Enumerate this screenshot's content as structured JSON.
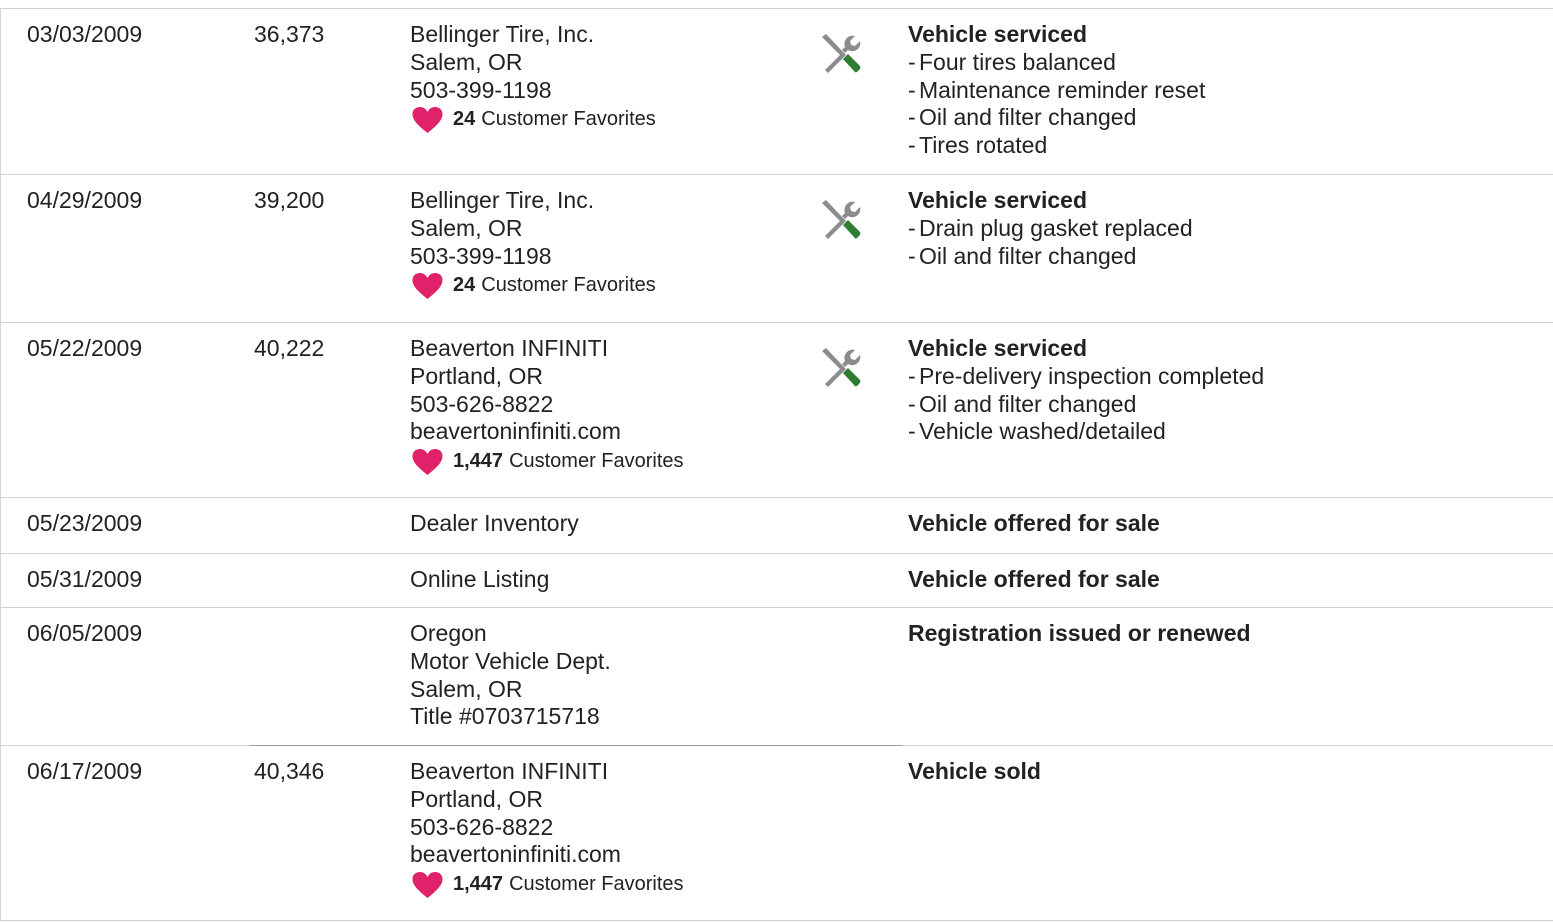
{
  "records": [
    {
      "date": "03/03/2009",
      "mileage": "36,373",
      "source": [
        "Bellinger Tire, Inc.",
        "Salem, OR",
        "503-399-1198"
      ],
      "favorites_count": "24",
      "favorites_label": "Customer Favorites",
      "icon": "service-tools-icon",
      "title": "Vehicle serviced",
      "items": [
        "Four tires balanced",
        "Maintenance reminder reset",
        "Oil and filter changed",
        "Tires rotated"
      ]
    },
    {
      "date": "04/29/2009",
      "mileage": "39,200",
      "source": [
        "Bellinger Tire, Inc.",
        "Salem, OR",
        "503-399-1198"
      ],
      "favorites_count": "24",
      "favorites_label": "Customer Favorites",
      "icon": "service-tools-icon",
      "title": "Vehicle serviced",
      "items": [
        "Drain plug gasket replaced",
        "Oil and filter changed"
      ]
    },
    {
      "date": "05/22/2009",
      "mileage": "40,222",
      "source": [
        "Beaverton INFINITI",
        "Portland, OR",
        "503-626-8822",
        "beavertoninfiniti.com"
      ],
      "favorites_count": "1,447",
      "favorites_label": "Customer Favorites",
      "icon": "service-tools-icon",
      "title": "Vehicle serviced",
      "items": [
        "Pre-delivery inspection completed",
        "Oil and filter changed",
        "Vehicle washed/detailed"
      ]
    },
    {
      "date": "05/23/2009",
      "mileage": "",
      "source": [
        "Dealer Inventory"
      ],
      "title": "Vehicle offered for sale",
      "items": []
    },
    {
      "date": "05/31/2009",
      "mileage": "",
      "source": [
        "Online Listing"
      ],
      "title": "Vehicle offered for sale",
      "items": []
    },
    {
      "date": "06/05/2009",
      "mileage": "",
      "source": [
        "Oregon",
        "Motor Vehicle Dept.",
        "Salem, OR",
        "Title #0703715718"
      ],
      "title": "Registration issued or renewed",
      "items": []
    },
    {
      "date": "06/17/2009",
      "mileage": "40,346",
      "source": [
        "Beaverton INFINITI",
        "Portland, OR",
        "503-626-8822",
        "beavertoninfiniti.com"
      ],
      "favorites_count": "1,447",
      "favorites_label": "Customer Favorites",
      "title": "Vehicle sold",
      "items": []
    }
  ],
  "colors": {
    "heart": "#e0226a",
    "wrench": "#8c8c8c",
    "screwdriver": "#2e7d32",
    "text": "#222222",
    "divider": "#cfcfcf"
  }
}
